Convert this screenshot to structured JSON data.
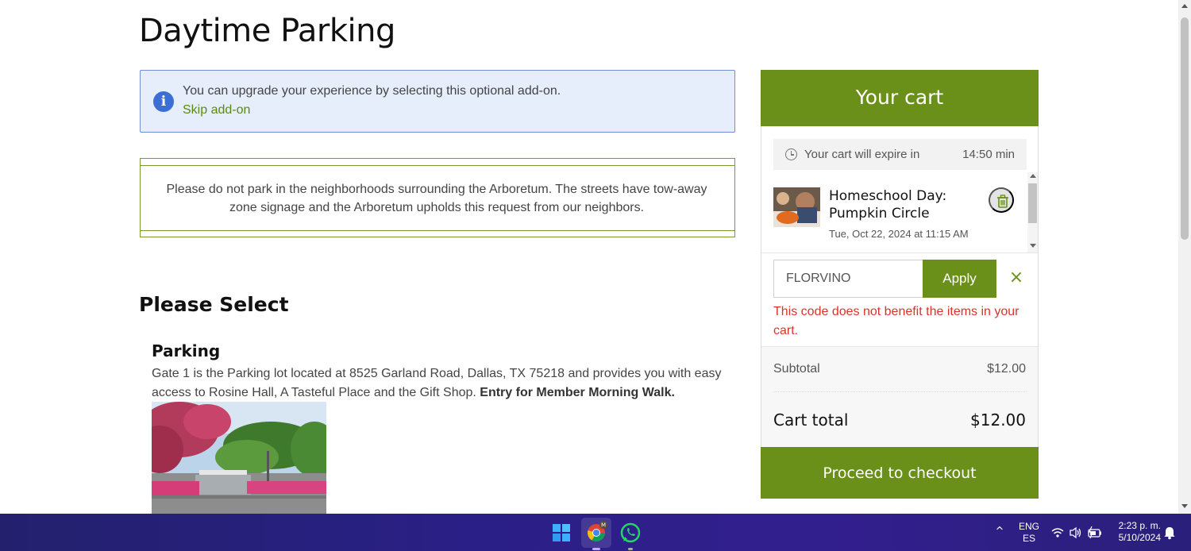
{
  "page": {
    "title": "Daytime Parking"
  },
  "info": {
    "message": "You can upgrade your experience by selecting this optional add-on.",
    "skip_link": "Skip add-on",
    "icon": "info-icon"
  },
  "notice": {
    "text": "Please do not park in the neighborhoods surrounding the Arboretum. The streets have tow-away zone signage and the Arboretum upholds this request from our neighbors."
  },
  "selection": {
    "heading": "Please Select",
    "option": {
      "title": "Parking",
      "description": "Gate 1 is the Parking lot located at 8525 Garland Road, Dallas, TX 75218 and provides you with easy access to Rosine Hall, A Tasteful Place and the Gift Shop.",
      "description_bold": "Entry for Member Morning Walk."
    }
  },
  "cart": {
    "title": "Your cart",
    "expire_label": "Your cart will expire in",
    "expire_value": "14:50 min",
    "items": [
      {
        "name": "Homeschool Day: Pumpkin Circle",
        "date": "Tue, Oct 22, 2024 at 11:15 AM"
      }
    ],
    "promo": {
      "value": "FLORVINO",
      "apply_label": "Apply",
      "clear_label": "×",
      "error": "This code does not benefit the items in your cart."
    },
    "subtotal_label": "Subtotal",
    "subtotal_value": "$12.00",
    "total_label": "Cart total",
    "total_value": "$12.00",
    "checkout_label": "Proceed to checkout"
  },
  "taskbar": {
    "chevron": "^",
    "lang_top": "ENG",
    "lang_bottom": "ES",
    "time": "2:23 p. m.",
    "date": "5/10/2024"
  },
  "colors": {
    "accent_green": "#6a9019",
    "info_blue": "#3b6fd6",
    "error_red": "#d9342b"
  }
}
